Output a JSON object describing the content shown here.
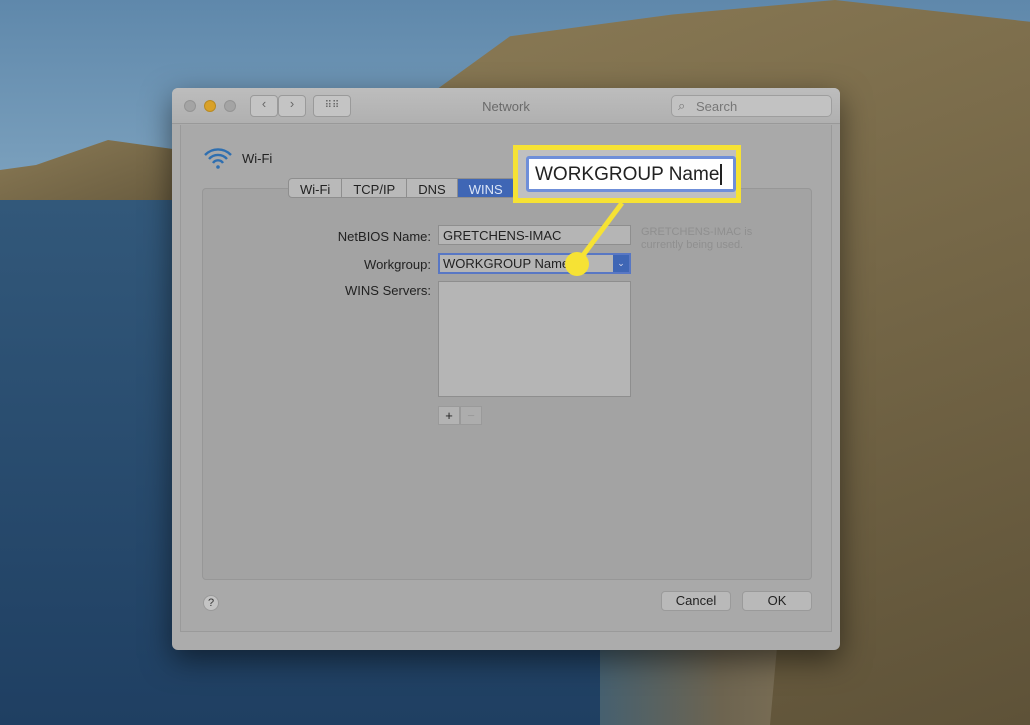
{
  "window": {
    "title": "Network",
    "search_placeholder": "Search"
  },
  "interface": {
    "name": "Wi-Fi",
    "icon": "wifi-icon"
  },
  "tabs": [
    {
      "label": "Wi-Fi"
    },
    {
      "label": "TCP/IP"
    },
    {
      "label": "DNS"
    },
    {
      "label": "WINS",
      "selected": true
    }
  ],
  "form": {
    "netbios_label": "NetBIOS Name:",
    "netbios_value": "GRETCHENS-IMAC",
    "netbios_note": "GRETCHENS-IMAC is currently being used.",
    "workgroup_label": "Workgroup:",
    "workgroup_value": "WORKGROUP Name",
    "wins_label": "WINS Servers:",
    "add": "+",
    "remove": "−"
  },
  "footer": {
    "help": "?",
    "cancel": "Cancel",
    "ok": "OK"
  },
  "callout": {
    "text": "WORKGROUP Name",
    "color": "#f6e234"
  },
  "colors": {
    "accent": "#3f66b5"
  }
}
